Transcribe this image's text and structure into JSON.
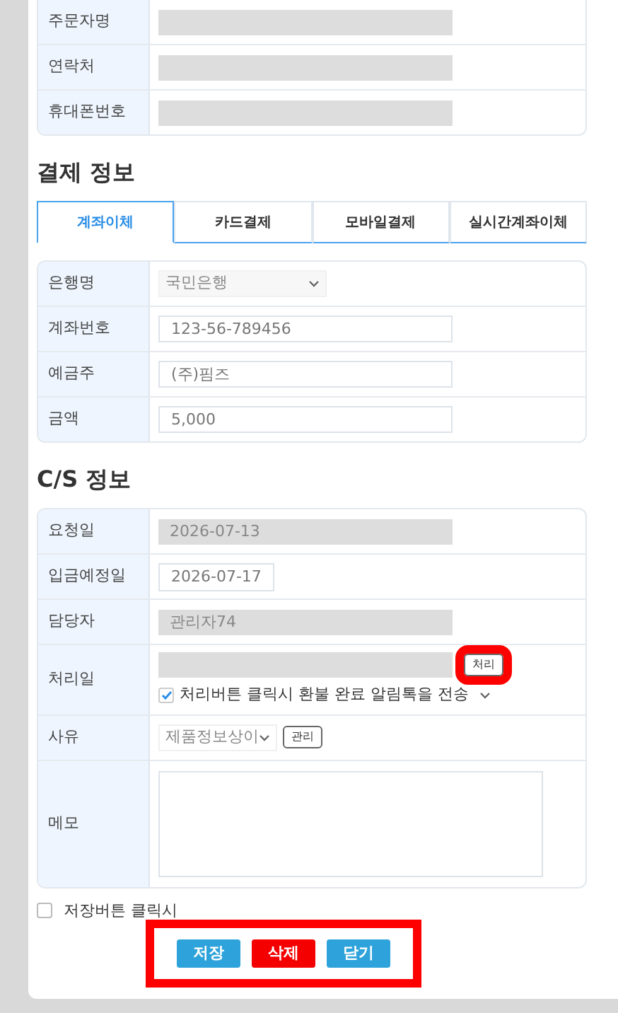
{
  "customer": {
    "rows": [
      {
        "label": "주문자명",
        "field": {
          "kind": "readonly"
        }
      },
      {
        "label": "연락처",
        "field": {
          "kind": "readonly"
        }
      },
      {
        "label": "휴대폰번호",
        "field": {
          "kind": "readonly"
        }
      }
    ]
  },
  "payment": {
    "title": "결제 정보",
    "tabs": [
      {
        "label": "계좌이체",
        "selected": true
      },
      {
        "label": "카드결제",
        "selected": false
      },
      {
        "label": "모바일결제",
        "selected": false
      },
      {
        "label": "실시간계좌이체",
        "selected": false
      }
    ],
    "rows": [
      {
        "label": "은행명",
        "field": {
          "kind": "select",
          "value": "국민은행"
        }
      },
      {
        "label": "계좌번호",
        "field": {
          "kind": "input",
          "value": "123-56-789456"
        }
      },
      {
        "label": "예금주",
        "field": {
          "kind": "input",
          "value": "(주)핌즈"
        }
      },
      {
        "label": "금액",
        "field": {
          "kind": "input",
          "value": "5,000"
        }
      }
    ]
  },
  "cs": {
    "title": "C/S 정보",
    "rows": [
      {
        "label": "요청일",
        "field": {
          "kind": "readonly",
          "value": "2026-07-13"
        }
      },
      {
        "label": "입금예정일",
        "field": {
          "kind": "date",
          "value": "2026-07-17"
        }
      },
      {
        "label": "담당자",
        "field": {
          "kind": "readonly",
          "value": "관리자74"
        }
      },
      {
        "label": "처리일",
        "field": {
          "kind": "process",
          "button": "처리",
          "highlighted": true,
          "notify": {
            "label": "처리버튼 클릭시 환불 완료 알림톡을 전송",
            "checked": true
          }
        }
      },
      {
        "label": "사유",
        "field": {
          "kind": "reason",
          "value": "제품정보상이",
          "button": "관리"
        }
      },
      {
        "label": "메모",
        "field": {
          "kind": "memo"
        }
      }
    ]
  },
  "save_option": {
    "label": "저장버튼 클릭시",
    "checked": false
  },
  "actions": {
    "highlighted": true,
    "buttons": [
      {
        "label": "저장",
        "kind": "primary"
      },
      {
        "label": "삭제",
        "kind": "danger"
      },
      {
        "label": "닫기",
        "kind": "primary"
      }
    ]
  }
}
